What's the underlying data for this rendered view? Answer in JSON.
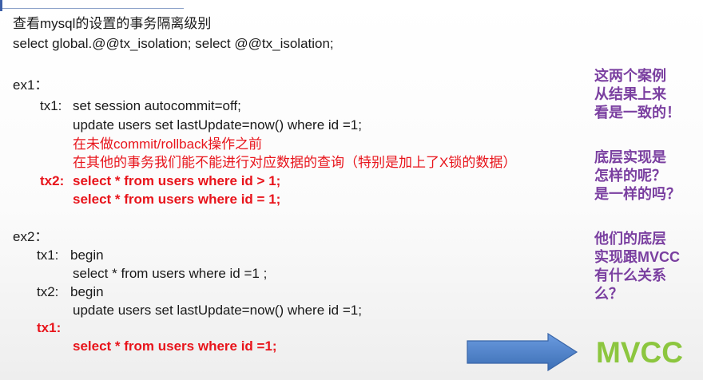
{
  "header": {
    "title": "查看mysql的设置的事务隔离级别",
    "command": "select global.@@tx_isolation;    select @@tx_isolation;"
  },
  "ex1": {
    "label": "ex1：",
    "tx1_label": "tx1:",
    "tx1_line1": "set session autocommit=off;",
    "tx1_line2": "update users set lastUpdate=now() where id =1;",
    "note_line1": "在未做commit/rollback操作之前",
    "note_line2": "在其他的事务我们能不能进行对应数据的查询（特别是加上了X锁的数据）",
    "tx2_label": "tx2:",
    "tx2_line1": "select * from users where id > 1;",
    "tx2_line2": "select * from users where id = 1;"
  },
  "ex2": {
    "label": "ex2：",
    "tx1_label": "tx1:",
    "tx1_line1": "begin",
    "tx1_line2": "select  * from users where id =1 ;",
    "tx2_label": "tx2:",
    "tx2_line1": "begin",
    "tx2_line2": "update users set lastUpdate=now() where id =1;",
    "tx1b_label": "tx1:",
    "tx1b_line1": "select * from users where id =1;"
  },
  "side_notes": {
    "note1": [
      "这两个案例",
      "从结果上来",
      "看是一致的！"
    ],
    "note2": [
      "底层实现是",
      "怎样的呢？",
      "是一样的吗？"
    ],
    "note3": [
      "他们的底层",
      "实现跟MVCC",
      "有什么关系",
      "么？"
    ]
  },
  "arrow_label": "MVCC",
  "colors": {
    "red": "#e8141b",
    "purple": "#7a3fa0",
    "green": "#8cc63f",
    "arrow_blue": "#4a7fc0"
  }
}
